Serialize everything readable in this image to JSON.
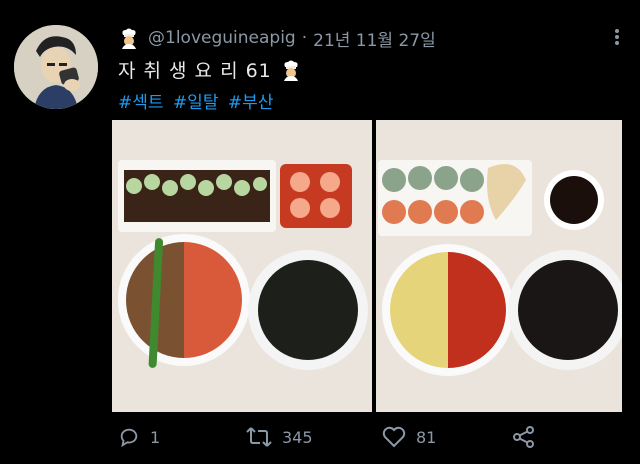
{
  "tweet": {
    "handle": "@1loveguineapig",
    "separator": "·",
    "date": "21년 11월 27일",
    "text": "자 취 생 요 리 61",
    "hashtags": [
      "#섹트",
      "#일탈",
      "#부산"
    ]
  },
  "actions": {
    "reply_count": "1",
    "retweet_count": "345",
    "like_count": "81"
  },
  "icons": {
    "avatar": "avatar",
    "chef": "chef-emoji-icon",
    "more": "more-icon",
    "reply": "reply-icon",
    "retweet": "retweet-icon",
    "like": "heart-icon",
    "share": "share-icon"
  },
  "colors": {
    "background": "#000000",
    "text": "#e7e9ea",
    "muted": "#8b98a5",
    "link": "#1d9bf0"
  }
}
